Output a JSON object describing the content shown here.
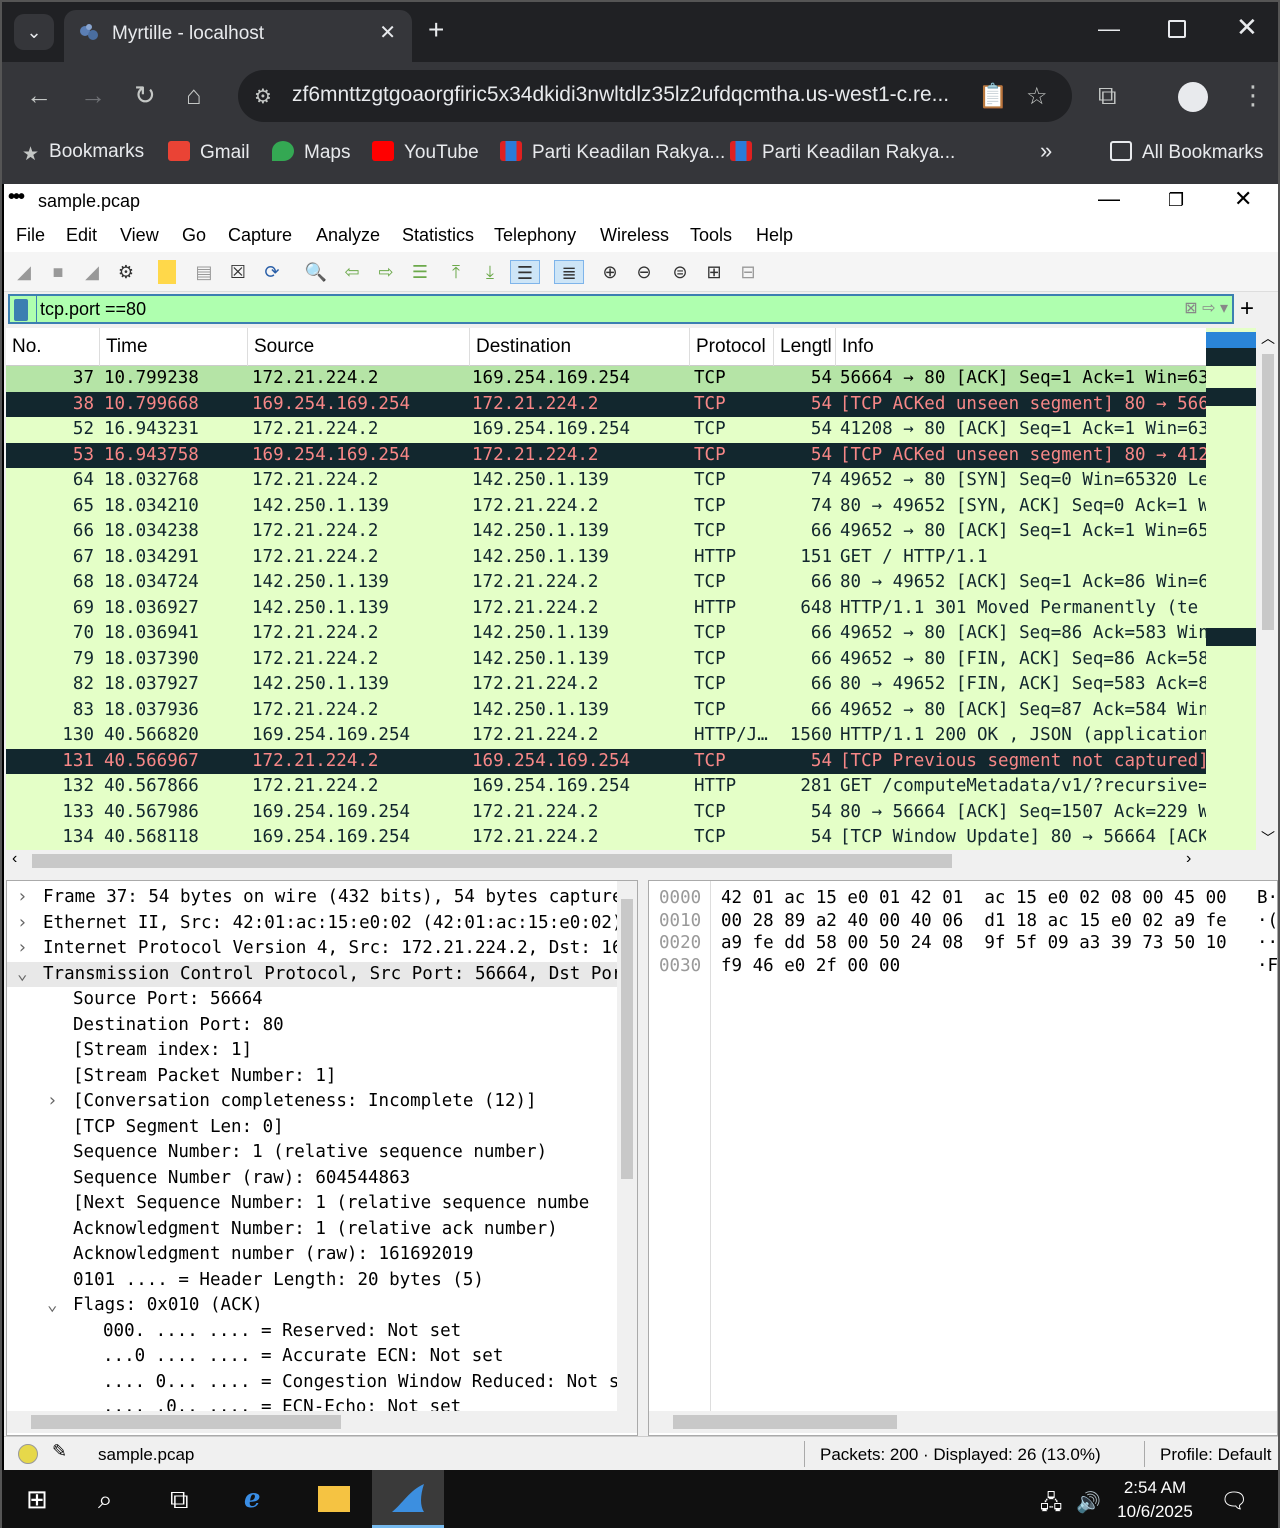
{
  "browser": {
    "tab_title": "Myrtille - localhost",
    "url": "zf6mnttzgtgoaorgfiric5x34dkidi3nwltdlz35lz2ufdqcmtha.us-west1-c.re...",
    "bookmarks": [
      "Bookmarks",
      "Gmail",
      "Maps",
      "YouTube",
      "Parti Keadilan Rakya...",
      "Parti Keadilan Rakya..."
    ],
    "all_bookmarks": "All Bookmarks",
    "overflow": "»"
  },
  "wireshark": {
    "window_title": "sample.pcap",
    "menu": [
      "File",
      "Edit",
      "View",
      "Go",
      "Capture",
      "Analyze",
      "Statistics",
      "Telephony",
      "Wireless",
      "Tools",
      "Help"
    ],
    "filter_value": "tcp.port ==80",
    "columns": [
      "No.",
      "Time",
      "Source",
      "Destination",
      "Protocol",
      "Lengtl",
      "Info"
    ],
    "packets": [
      {
        "no": "37",
        "time": "10.799238",
        "src": "172.21.224.2",
        "dst": "169.254.169.254",
        "proto": "TCP",
        "len": "54",
        "info": "56664 → 80 [ACK] Seq=1 Ack=1 Win=63",
        "style": "sel"
      },
      {
        "no": "38",
        "time": "10.799668",
        "src": "169.254.169.254",
        "dst": "172.21.224.2",
        "proto": "TCP",
        "len": "54",
        "info": "[TCP ACKed unseen segment] 80 → 566",
        "style": "blk"
      },
      {
        "no": "52",
        "time": "16.943231",
        "src": "172.21.224.2",
        "dst": "169.254.169.254",
        "proto": "TCP",
        "len": "54",
        "info": "41208 → 80 [ACK] Seq=1 Ack=1 Win=63",
        "style": "g"
      },
      {
        "no": "53",
        "time": "16.943758",
        "src": "169.254.169.254",
        "dst": "172.21.224.2",
        "proto": "TCP",
        "len": "54",
        "info": "[TCP ACKed unseen segment] 80 → 412",
        "style": "blk"
      },
      {
        "no": "64",
        "time": "18.032768",
        "src": "172.21.224.2",
        "dst": "142.250.1.139",
        "proto": "TCP",
        "len": "74",
        "info": "49652 → 80 [SYN] Seq=0 Win=65320 Le",
        "style": "g"
      },
      {
        "no": "65",
        "time": "18.034210",
        "src": "142.250.1.139",
        "dst": "172.21.224.2",
        "proto": "TCP",
        "len": "74",
        "info": "80 → 49652 [SYN, ACK] Seq=0 Ack=1 W",
        "style": "g"
      },
      {
        "no": "66",
        "time": "18.034238",
        "src": "172.21.224.2",
        "dst": "142.250.1.139",
        "proto": "TCP",
        "len": "66",
        "info": "49652 → 80 [ACK] Seq=1 Ack=1 Win=65",
        "style": "g"
      },
      {
        "no": "67",
        "time": "18.034291",
        "src": "172.21.224.2",
        "dst": "142.250.1.139",
        "proto": "HTTP",
        "len": "151",
        "info": "GET / HTTP/1.1",
        "style": "g"
      },
      {
        "no": "68",
        "time": "18.034724",
        "src": "142.250.1.139",
        "dst": "172.21.224.2",
        "proto": "TCP",
        "len": "66",
        "info": "80 → 49652 [ACK] Seq=1 Ack=86 Win=6",
        "style": "g"
      },
      {
        "no": "69",
        "time": "18.036927",
        "src": "142.250.1.139",
        "dst": "172.21.224.2",
        "proto": "HTTP",
        "len": "648",
        "info": "HTTP/1.1 301 Moved Permanently  (te",
        "style": "g"
      },
      {
        "no": "70",
        "time": "18.036941",
        "src": "172.21.224.2",
        "dst": "142.250.1.139",
        "proto": "TCP",
        "len": "66",
        "info": "49652 → 80 [ACK] Seq=86 Ack=583 Win",
        "style": "g"
      },
      {
        "no": "79",
        "time": "18.037390",
        "src": "172.21.224.2",
        "dst": "142.250.1.139",
        "proto": "TCP",
        "len": "66",
        "info": "49652 → 80 [FIN, ACK] Seq=86 Ack=58",
        "style": "g"
      },
      {
        "no": "82",
        "time": "18.037927",
        "src": "142.250.1.139",
        "dst": "172.21.224.2",
        "proto": "TCP",
        "len": "66",
        "info": "80 → 49652 [FIN, ACK] Seq=583 Ack=8",
        "style": "g"
      },
      {
        "no": "83",
        "time": "18.037936",
        "src": "172.21.224.2",
        "dst": "142.250.1.139",
        "proto": "TCP",
        "len": "66",
        "info": "49652 → 80 [ACK] Seq=87 Ack=584 Win",
        "style": "g"
      },
      {
        "no": "130",
        "time": "40.566820",
        "src": "169.254.169.254",
        "dst": "172.21.224.2",
        "proto": "HTTP/J…",
        "len": "1560",
        "info": "HTTP/1.1 200 OK , JSON (application",
        "style": "g"
      },
      {
        "no": "131",
        "time": "40.566967",
        "src": "172.21.224.2",
        "dst": "169.254.169.254",
        "proto": "TCP",
        "len": "54",
        "info": "[TCP Previous segment not captured]",
        "style": "blk"
      },
      {
        "no": "132",
        "time": "40.567866",
        "src": "172.21.224.2",
        "dst": "169.254.169.254",
        "proto": "HTTP",
        "len": "281",
        "info": "GET /computeMetadata/v1/?recursive=",
        "style": "g"
      },
      {
        "no": "133",
        "time": "40.567986",
        "src": "169.254.169.254",
        "dst": "172.21.224.2",
        "proto": "TCP",
        "len": "54",
        "info": "80 → 56664 [ACK] Seq=1507 Ack=229 W",
        "style": "g"
      },
      {
        "no": "134",
        "time": "40.568118",
        "src": "169.254.169.254",
        "dst": "172.21.224.2",
        "proto": "TCP",
        "len": "54",
        "info": "[TCP Window Update] 80 → 56664 [ACK",
        "style": "g"
      }
    ],
    "details": [
      {
        "indent": 0,
        "arrow": "›",
        "text": "Frame 37: 54 bytes on wire (432 bits), 54 bytes capture"
      },
      {
        "indent": 0,
        "arrow": "›",
        "text": "Ethernet II, Src: 42:01:ac:15:e0:02 (42:01:ac:15:e0:02)"
      },
      {
        "indent": 0,
        "arrow": "›",
        "text": "Internet Protocol Version 4, Src: 172.21.224.2, Dst: 16"
      },
      {
        "indent": 0,
        "arrow": "⌄",
        "text": "Transmission Control Protocol, Src Port: 56664, Dst Por",
        "hl": true
      },
      {
        "indent": 1,
        "arrow": "",
        "text": "Source Port: 56664"
      },
      {
        "indent": 1,
        "arrow": "",
        "text": "Destination Port: 80"
      },
      {
        "indent": 1,
        "arrow": "",
        "text": "[Stream index: 1]"
      },
      {
        "indent": 1,
        "arrow": "",
        "text": "[Stream Packet Number: 1]"
      },
      {
        "indent": 1,
        "arrow": "›",
        "text": "[Conversation completeness: Incomplete (12)]"
      },
      {
        "indent": 1,
        "arrow": "",
        "text": "[TCP Segment Len: 0]"
      },
      {
        "indent": 1,
        "arrow": "",
        "text": "Sequence Number: 1    (relative sequence number)"
      },
      {
        "indent": 1,
        "arrow": "",
        "text": "Sequence Number (raw): 604544863"
      },
      {
        "indent": 1,
        "arrow": "",
        "text": "[Next Sequence Number: 1    (relative sequence numbe"
      },
      {
        "indent": 1,
        "arrow": "",
        "text": "Acknowledgment Number: 1    (relative ack number)"
      },
      {
        "indent": 1,
        "arrow": "",
        "text": "Acknowledgment number (raw): 161692019"
      },
      {
        "indent": 1,
        "arrow": "",
        "text": "0101 .... = Header Length: 20 bytes (5)"
      },
      {
        "indent": 1,
        "arrow": "⌄",
        "text": "Flags: 0x010 (ACK)"
      },
      {
        "indent": 2,
        "arrow": "",
        "text": "000. .... .... = Reserved: Not set"
      },
      {
        "indent": 2,
        "arrow": "",
        "text": "...0 .... .... = Accurate ECN: Not set"
      },
      {
        "indent": 2,
        "arrow": "",
        "text": ".... 0... .... = Congestion Window Reduced: Not s"
      },
      {
        "indent": 2,
        "arrow": "",
        "text": ".... .0.. .... = ECN-Echo: Not set"
      }
    ],
    "hex": [
      {
        "off": "0000",
        "hex": "42 01 ac 15 e0 01 42 01  ac 15 e0 02 08 00 45 00",
        "asc": "B·"
      },
      {
        "off": "0010",
        "hex": "00 28 89 a2 40 00 40 06  d1 18 ac 15 e0 02 a9 fe",
        "asc": "·("
      },
      {
        "off": "0020",
        "hex": "a9 fe dd 58 00 50 24 08  9f 5f 09 a3 39 73 50 10",
        "asc": "··"
      },
      {
        "off": "0030",
        "hex": "f9 46 e0 2f 00 00",
        "asc": "·F"
      }
    ],
    "status": {
      "file": "sample.pcap",
      "packets": "Packets: 200 · Displayed: 26 (13.0%)",
      "profile": "Profile: Default"
    }
  },
  "taskbar": {
    "time": "2:54 AM",
    "date": "10/6/2025"
  }
}
